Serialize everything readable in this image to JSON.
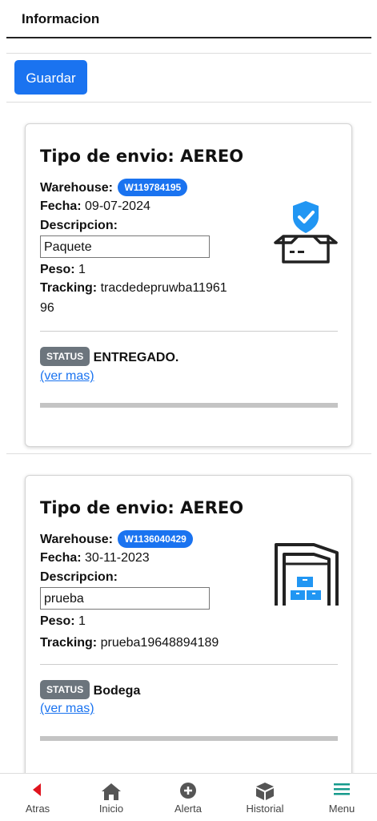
{
  "header": {
    "title": "Informacion"
  },
  "toolbar": {
    "save_label": "Guardar"
  },
  "shipments": [
    {
      "title": "Tipo de envio: AEREO",
      "warehouse_label": "Warehouse:",
      "warehouse_id": "W119784195",
      "date_label": "Fecha:",
      "date": "09-07-2024",
      "description_label": "Descripcion:",
      "description": "Paquete",
      "weight_label": "Peso:",
      "weight": "1",
      "tracking_label": "Tracking:",
      "tracking": "tracdedepruwba1196196",
      "status_badge": "STATUS",
      "status": "ENTREGADO.",
      "more_link": "(ver mas)",
      "icon": "package-delivered-icon",
      "progress": 1.0
    },
    {
      "title": "Tipo de envio: AEREO",
      "warehouse_label": "Warehouse:",
      "warehouse_id": "W1136040429",
      "date_label": "Fecha:",
      "date": "30-11-2023",
      "description_label": "Descripcion:",
      "description": "prueba",
      "weight_label": "Peso:",
      "weight": "1",
      "tracking_label": "Tracking:",
      "tracking": "prueba19648894189",
      "status_badge": "STATUS",
      "status": "Bodega",
      "more_link": "(ver mas)",
      "icon": "warehouse-icon",
      "progress": 1.0
    }
  ],
  "nav": {
    "back": "Atras",
    "home": "Inicio",
    "alert": "Alerta",
    "history": "Historial",
    "menu": "Menu"
  },
  "colors": {
    "accent": "#1a73f0",
    "status_badge": "#6c757d",
    "menu_active": "#159a8c",
    "back_arrow": "#e0141e"
  }
}
